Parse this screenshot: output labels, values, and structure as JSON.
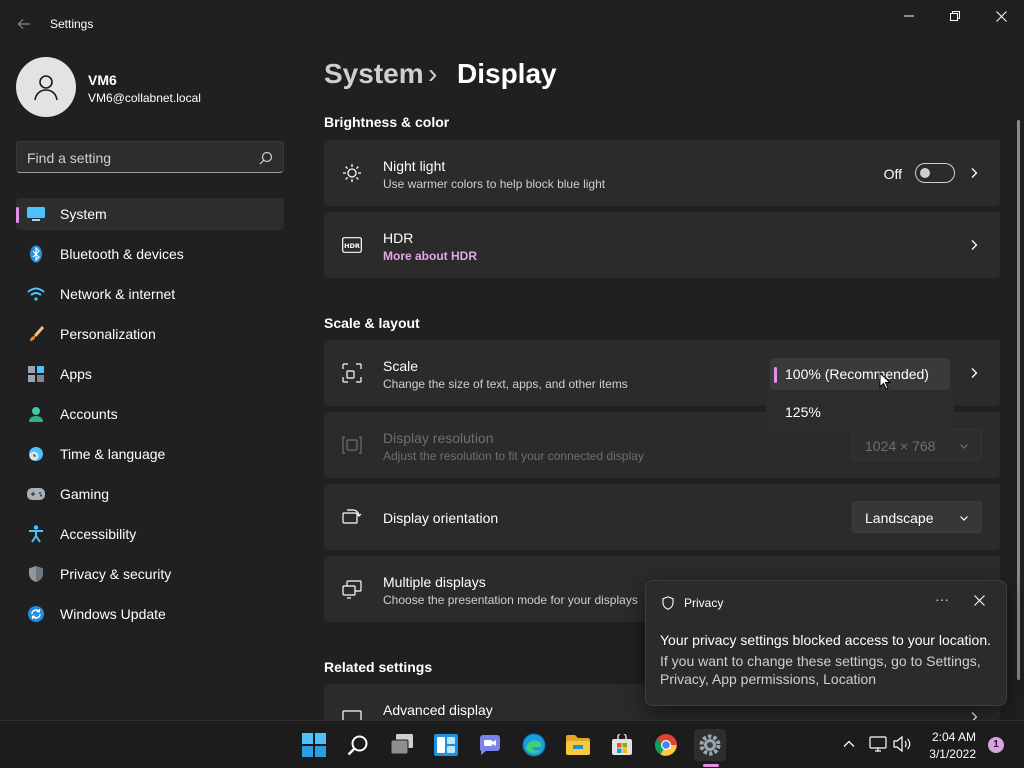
{
  "window": {
    "title": "Settings"
  },
  "user": {
    "name": "VM6",
    "email": "VM6@collabnet.local"
  },
  "search": {
    "placeholder": "Find a setting"
  },
  "nav": [
    {
      "label": "System",
      "icon": "monitor-icon"
    },
    {
      "label": "Bluetooth & devices",
      "icon": "bluetooth-icon"
    },
    {
      "label": "Network & internet",
      "icon": "wifi-icon"
    },
    {
      "label": "Personalization",
      "icon": "brush-icon"
    },
    {
      "label": "Apps",
      "icon": "apps-icon"
    },
    {
      "label": "Accounts",
      "icon": "person-icon"
    },
    {
      "label": "Time & language",
      "icon": "globe-clock-icon"
    },
    {
      "label": "Gaming",
      "icon": "gamepad-icon"
    },
    {
      "label": "Accessibility",
      "icon": "accessibility-icon"
    },
    {
      "label": "Privacy & security",
      "icon": "shield-icon"
    },
    {
      "label": "Windows Update",
      "icon": "update-icon"
    }
  ],
  "breadcrumb": {
    "parent": "System",
    "separator": "›",
    "current": "Display"
  },
  "sections": {
    "brightness": "Brightness & color",
    "scale_layout": "Scale & layout",
    "related": "Related settings"
  },
  "cards": {
    "night_light": {
      "title": "Night light",
      "sub": "Use warmer colors to help block blue light",
      "toggle_label": "Off",
      "toggle_on": false
    },
    "hdr": {
      "title": "HDR",
      "link": "More about HDR"
    },
    "scale": {
      "title": "Scale",
      "sub": "Change the size of text, apps, and other items"
    },
    "resolution": {
      "title": "Display resolution",
      "sub": "Adjust the resolution to fit your connected display",
      "value": "1024 × 768"
    },
    "orientation": {
      "title": "Display orientation",
      "value": "Landscape"
    },
    "multiple": {
      "title": "Multiple displays",
      "sub": "Choose the presentation mode for your displays"
    },
    "advanced": {
      "title": "Advanced display"
    }
  },
  "scale_flyout": {
    "options": [
      "100% (Recommended)",
      "125%"
    ],
    "selected": "100% (Recommended)"
  },
  "toast": {
    "app": "Privacy",
    "message": "Your privacy settings blocked access to your location.",
    "body": "If you want to change these settings, go to Settings, Privacy, App permissions, Location"
  },
  "taskbar": {
    "time": "2:04 AM",
    "date": "3/1/2022",
    "notification_count": "1",
    "apps": [
      "start-icon",
      "search-icon",
      "task-view-icon",
      "widgets-icon",
      "teams-chat-icon",
      "edge-icon",
      "file-explorer-icon",
      "store-icon",
      "chrome-icon",
      "settings-icon"
    ]
  },
  "colors": {
    "accent": "#e58ee6",
    "background": "#202020",
    "card": "#2b2b2b",
    "link": "#e3a7e7"
  }
}
